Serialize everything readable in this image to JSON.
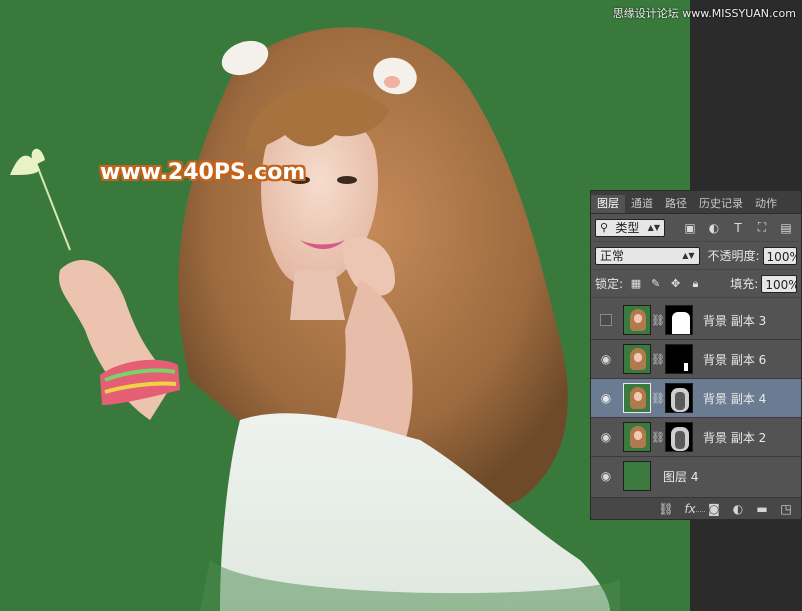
{
  "watermark": {
    "text": "www.240PS.com"
  },
  "site_credit": {
    "text": "思缘设计论坛 www.MISSYUAN.com"
  },
  "layers_panel": {
    "tabs": [
      {
        "label": "图层",
        "active": true
      },
      {
        "label": "通道",
        "active": false
      },
      {
        "label": "路径",
        "active": false
      },
      {
        "label": "历史记录",
        "active": false
      },
      {
        "label": "动作",
        "active": false
      }
    ],
    "filter": {
      "label": "类型"
    },
    "filter_icons": [
      "image-filter-icon",
      "adjustment-filter-icon",
      "type-filter-icon",
      "shape-filter-icon",
      "smart-object-filter-icon"
    ],
    "blend_mode": {
      "value": "正常"
    },
    "opacity": {
      "label": "不透明度:",
      "value": "100%"
    },
    "lock": {
      "label": "锁定:"
    },
    "fill": {
      "label": "填充:",
      "value": "100%"
    },
    "layers": [
      {
        "name": "背景 副本 3",
        "visible": false,
        "selected": false,
        "mask": "figure"
      },
      {
        "name": "背景 副本 6",
        "visible": true,
        "selected": false,
        "mask": "dot"
      },
      {
        "name": "背景 副本 4",
        "visible": true,
        "selected": true,
        "mask": "soft"
      },
      {
        "name": "背景 副本 2",
        "visible": true,
        "selected": false,
        "mask": "soft"
      },
      {
        "name": "图层 4",
        "visible": true,
        "selected": false,
        "mask": "none"
      }
    ],
    "footer_icons": [
      "link-icon",
      "fx-icon",
      "mask-icon",
      "adjustment-icon",
      "folder-icon",
      "new-layer-icon"
    ]
  },
  "colors": {
    "background_green": "#397a3c",
    "panel_bg": "#535353",
    "selected_row": "#6b7c92",
    "watermark_outline": "#c4631a"
  }
}
